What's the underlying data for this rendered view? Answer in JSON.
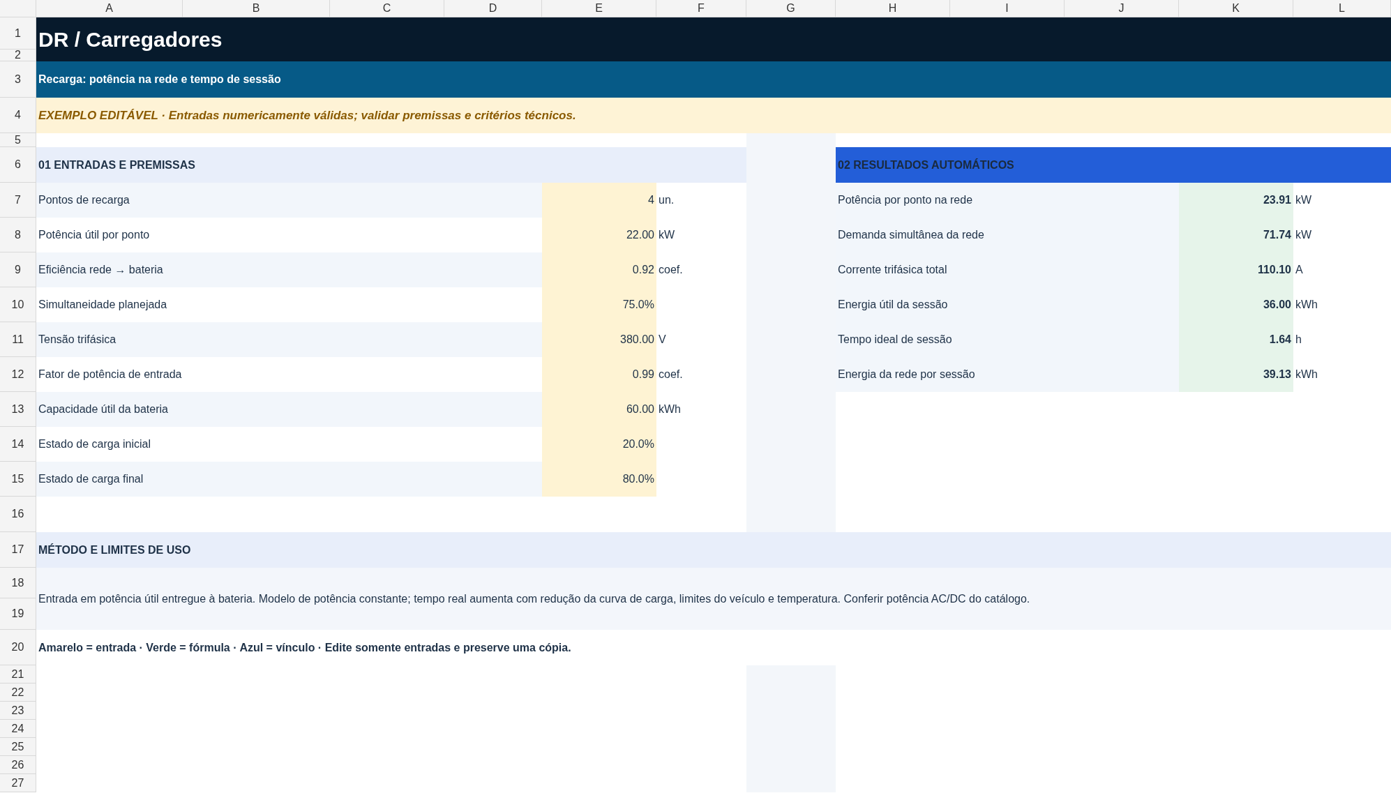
{
  "columns": [
    "A",
    "B",
    "C",
    "D",
    "E",
    "F",
    "G",
    "H",
    "I",
    "J",
    "K",
    "L"
  ],
  "rows": [
    "1",
    "2",
    "3",
    "4",
    "5",
    "6",
    "7",
    "8",
    "9",
    "10",
    "11",
    "12",
    "13",
    "14",
    "15",
    "16",
    "17",
    "18",
    "19",
    "20",
    "21",
    "22",
    "23",
    "24",
    "25",
    "26",
    "27"
  ],
  "title": "DR / Carregadores",
  "subtitle": "Recarga: potência na rede e tempo de sessão",
  "notice": "EXEMPLO EDITÁVEL · Entradas numericamente válidas; validar premissas e critérios técnicos.",
  "inputs": {
    "header": "01 ENTRADAS E PREMISSAS",
    "items": [
      {
        "label": "Pontos de recarga",
        "value": "4",
        "unit": "un."
      },
      {
        "label": "Potência útil por ponto",
        "value": "22.00",
        "unit": "kW"
      },
      {
        "label": "Eficiência rede → bateria",
        "value": "0.92",
        "unit": "coef."
      },
      {
        "label": "Simultaneidade planejada",
        "value": "75.0%"
      },
      {
        "label": "Tensão trifásica",
        "value": "380.00",
        "unit": "V"
      },
      {
        "label": "Fator de potência de entrada",
        "value": "0.99",
        "unit": "coef."
      },
      {
        "label": "Capacidade útil da bateria",
        "value": "60.00",
        "unit": "kWh"
      },
      {
        "label": "Estado de carga inicial",
        "value": "20.0%"
      },
      {
        "label": "Estado de carga final",
        "value": "80.0%"
      }
    ]
  },
  "results": {
    "header": "02 RESULTADOS AUTOMÁTICOS",
    "items": [
      {
        "label": "Potência por ponto na rede",
        "value": "23.91",
        "unit": "kW"
      },
      {
        "label": "Demanda simultânea da rede",
        "value": "71.74",
        "unit": "kW"
      },
      {
        "label": "Corrente trifásica total",
        "value": "110.10",
        "unit": "A"
      },
      {
        "label": "Energia útil da sessão",
        "value": "36.00",
        "unit": "kWh"
      },
      {
        "label": "Tempo ideal de sessão",
        "value": "1.64",
        "unit": "h"
      },
      {
        "label": "Energia da rede por sessão",
        "value": "39.13",
        "unit": "kWh"
      }
    ]
  },
  "method": {
    "header": "MÉTODO E LIMITES DE USO",
    "note": "Entrada em potência útil entregue à bateria. Modelo de potência constante; tempo real aumenta com redução da curva de carga, limites do veículo e temperatura. Conferir potência AC/DC do catálogo."
  },
  "legend": "Amarelo = entrada · Verde = fórmula · Azul = vínculo · Edite somente entradas e preserve uma cópia."
}
